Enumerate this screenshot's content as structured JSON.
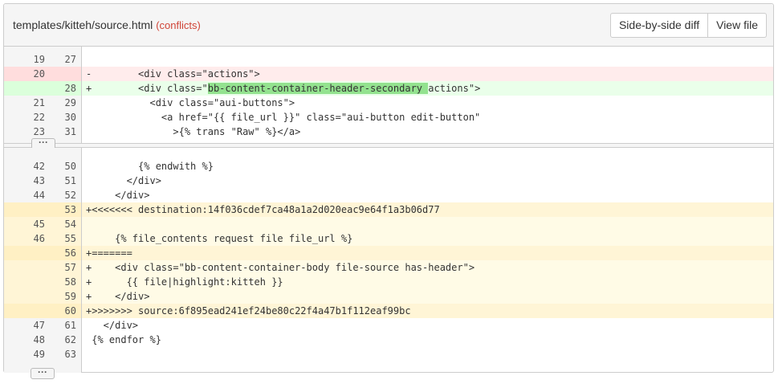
{
  "header": {
    "file_path": "templates/kitteh/source.html",
    "status": "(conflicts)",
    "buttons": {
      "side_by_side": "Side-by-side diff",
      "view_file": "View file"
    }
  },
  "expander_label": "···",
  "hunks": [
    {
      "lines": [
        {
          "type": "context",
          "old": "19",
          "new": "27",
          "code": ""
        },
        {
          "type": "removed",
          "old": "20",
          "new": "",
          "code": "-        <div class=\"actions\">"
        },
        {
          "type": "added",
          "old": "",
          "new": "28",
          "code_before": "+        <div class=\"",
          "code_highlight": "bb-content-container-header-secondary ",
          "code_after": "actions\">"
        },
        {
          "type": "context",
          "old": "21",
          "new": "29",
          "code": "           <div class=\"aui-buttons\">"
        },
        {
          "type": "context",
          "old": "22",
          "new": "30",
          "code": "             <a href=\"{{ file_url }}\" class=\"aui-button edit-button\""
        },
        {
          "type": "context",
          "old": "23",
          "new": "31",
          "code": "               >{% trans \"Raw\" %}</a>"
        }
      ]
    },
    {
      "lines": [
        {
          "type": "context",
          "old": "42",
          "new": "50",
          "code": "         {% endwith %}"
        },
        {
          "type": "context",
          "old": "43",
          "new": "51",
          "code": "       </div>"
        },
        {
          "type": "context",
          "old": "44",
          "new": "52",
          "code": "     </div>"
        },
        {
          "type": "conflict",
          "old": "",
          "new": "53",
          "code": "+<<<<<<< destination:14f036cdef7ca48a1a2d020eac9e64f1a3b06d77"
        },
        {
          "type": "conflict-body",
          "old": "45",
          "new": "54",
          "code": ""
        },
        {
          "type": "conflict-body",
          "old": "46",
          "new": "55",
          "code": "     {% file_contents request file file_url %}"
        },
        {
          "type": "conflict",
          "old": "",
          "new": "56",
          "code": "+======="
        },
        {
          "type": "conflict-body",
          "old": "",
          "new": "57",
          "code": "+    <div class=\"bb-content-container-body file-source has-header\">"
        },
        {
          "type": "conflict-body",
          "old": "",
          "new": "58",
          "code": "+      {{ file|highlight:kitteh }}"
        },
        {
          "type": "conflict-body",
          "old": "",
          "new": "59",
          "code": "+    </div>"
        },
        {
          "type": "conflict",
          "old": "",
          "new": "60",
          "code": "+>>>>>>> source:6f895ead241ef24be80c22f4a47b1f112eaf99bc"
        },
        {
          "type": "context",
          "old": "47",
          "new": "61",
          "code": "   </div>"
        },
        {
          "type": "context",
          "old": "48",
          "new": "62",
          "code": " {% endfor %}"
        },
        {
          "type": "context",
          "old": "49",
          "new": "63",
          "code": ""
        }
      ]
    }
  ]
}
